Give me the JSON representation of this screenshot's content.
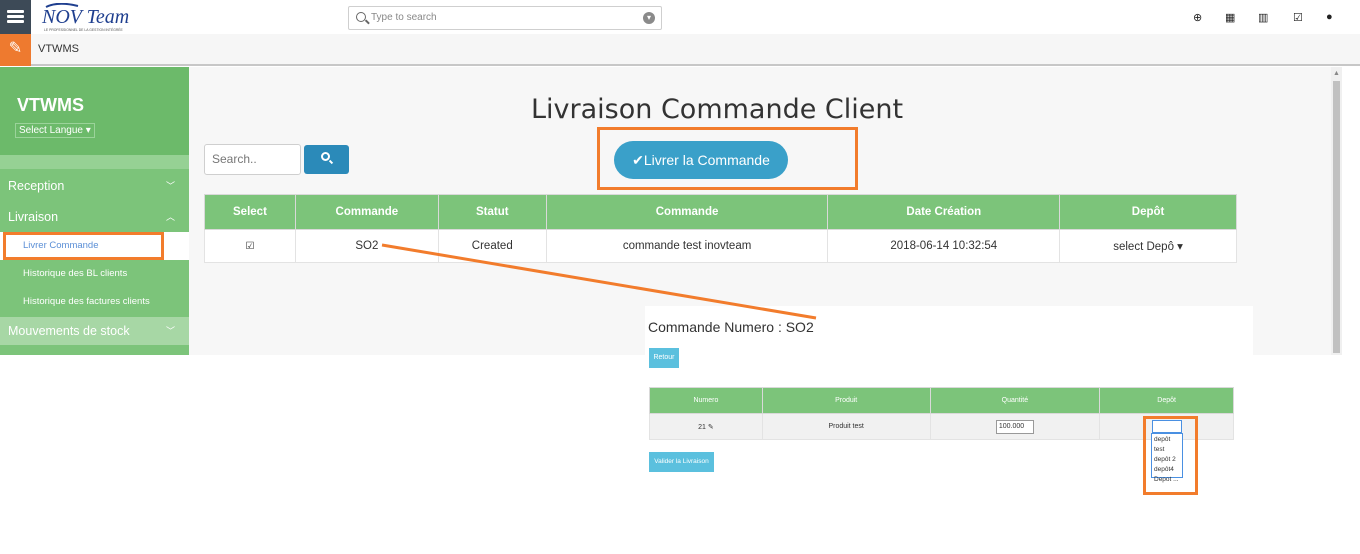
{
  "topbar": {
    "search_placeholder": "Type to search",
    "icons": [
      "menu-icon",
      "plus-circle-icon",
      "calendar-icon",
      "bar-chart-icon",
      "checkbox-icon",
      "user-icon"
    ]
  },
  "logo": {
    "brand": "NOV Team",
    "tagline": "LE PROFESSIONNEL DE LA GESTION INTÉGRÉE"
  },
  "subbar": {
    "title": "VTWMS"
  },
  "sidebar": {
    "title": "VTWMS",
    "lang_select": "Select Langue",
    "items": [
      {
        "label": "Reception"
      },
      {
        "label": "Livraison"
      },
      {
        "label": "Livrer Commande"
      },
      {
        "label": "Historique des BL clients"
      },
      {
        "label": "Historique des factures clients"
      },
      {
        "label": "Mouvements de stock"
      }
    ]
  },
  "main": {
    "title": "Livraison Commande Client",
    "search_placeholder": "Search..",
    "livrer_label": "Livrer la Commande",
    "table": {
      "headers": [
        "Select",
        "Commande",
        "Statut",
        "Commande",
        "Date Création",
        "Depôt"
      ],
      "rows": [
        {
          "commande": "SO2",
          "statut": "Created",
          "description": "commande test inovteam",
          "date": "2018-06-14 10:32:54",
          "depot": "select Depô"
        }
      ]
    }
  },
  "detail": {
    "title": "Commande Numero : SO2",
    "retour_label": "Retour",
    "headers": [
      "Numero",
      "Produit",
      "Quantité",
      "Depôt"
    ],
    "rows": [
      {
        "numero": "21",
        "produit": "Produit test",
        "quantite": "100.000"
      }
    ],
    "valider_label": "Valider la Livraison",
    "depot_options": [
      "depôt test",
      "depôt 2",
      "depôt4",
      "Depot ..."
    ]
  },
  "colors": {
    "accent_green": "#7cc47a",
    "highlight_orange": "#f27c2c",
    "button_blue": "#3aa0c9"
  }
}
